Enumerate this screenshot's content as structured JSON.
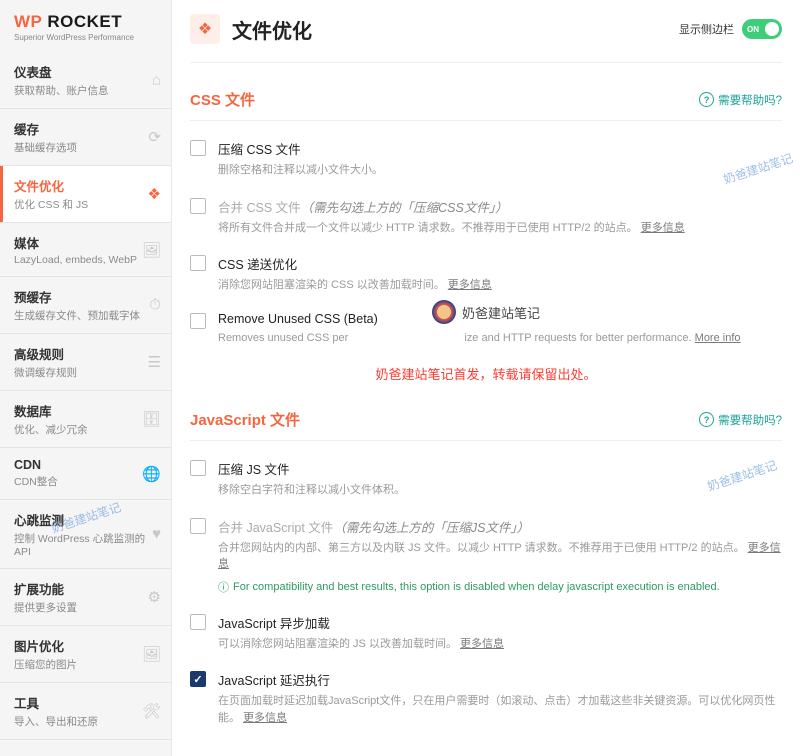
{
  "logo": {
    "wp": "WP",
    "rocket": "ROCKET",
    "tagline": "Superior WordPress Performance"
  },
  "nav": [
    {
      "title": "仪表盘",
      "sub": "获取帮助、账户信息",
      "icon": "⌂"
    },
    {
      "title": "缓存",
      "sub": "基础缓存选项",
      "icon": "⟳"
    },
    {
      "title": "文件优化",
      "sub": "优化 CSS 和 JS",
      "icon": "❖"
    },
    {
      "title": "媒体",
      "sub": "LazyLoad, embeds, WebP",
      "icon": "🖼"
    },
    {
      "title": "预缓存",
      "sub": "生成缓存文件、预加载字体",
      "icon": "⏱"
    },
    {
      "title": "高级规则",
      "sub": "微调缓存规则",
      "icon": "☰"
    },
    {
      "title": "数据库",
      "sub": "优化、减少冗余",
      "icon": "🗄"
    },
    {
      "title": "CDN",
      "sub": "CDN整合",
      "icon": "🌐"
    },
    {
      "title": "心跳监测",
      "sub": "控制 WordPress 心跳监测的 API",
      "icon": "♥"
    },
    {
      "title": "扩展功能",
      "sub": "提供更多设置",
      "icon": "⚙"
    },
    {
      "title": "图片优化",
      "sub": "压缩您的图片",
      "icon": "🖼"
    },
    {
      "title": "工具",
      "sub": "导入、导出和还原",
      "icon": "🛠"
    }
  ],
  "header": {
    "icon": "❖",
    "title": "文件优化",
    "toggle_label": "显示侧边栏",
    "toggle_state": "ON"
  },
  "help_label": "需要帮助吗?",
  "more_info": "更多信息",
  "more_info_en": "More info",
  "sections": {
    "css": {
      "title": "CSS 文件",
      "options": [
        {
          "title": "压缩 CSS 文件",
          "desc": "删除空格和注释以减小文件大小。"
        },
        {
          "title": "合并 CSS 文件",
          "title_note": "（需先勾选上方的「压缩CSS文件」）",
          "desc": "将所有文件合并成一个文件以减少 HTTP 请求数。不推荐用于已使用 HTTP/2 的站点。",
          "more": true,
          "disabled": true
        },
        {
          "title": "CSS 递送优化",
          "desc": "消除您网站阻塞渲染的 CSS 以改善加载时间。",
          "more": true
        },
        {
          "title": "Remove Unused CSS (Beta)",
          "desc_pre": "Removes unused CSS per",
          "desc_post": "ize and HTTP requests for better performance.",
          "more_en": true
        }
      ]
    },
    "js": {
      "title": "JavaScript 文件",
      "options": [
        {
          "title": "压缩 JS 文件",
          "desc": "移除空白字符和注释以减小文件体积。"
        },
        {
          "title": "合并 JavaScript 文件",
          "title_note": "（需先勾选上方的「压缩JS文件」）",
          "desc": "合并您网站内的内部、第三方以及内联 JS 文件。以减少 HTTP 请求数。不推荐用于已使用 HTTP/2 的站点。",
          "more": true,
          "disabled": true,
          "compat": "For compatibility and best results, this option is disabled when delay javascript execution is enabled."
        },
        {
          "title": "JavaScript 异步加载",
          "desc": "可以消除您网站阻塞渲染的 JS 以改善加载时间。",
          "more": true
        },
        {
          "title": "JavaScript 延迟执行",
          "desc": "在页面加载时延迟加载JavaScript文件，只在用户需要时（如滚动、点击）才加载这些非关键资源。可以优化网页性能。",
          "more": true,
          "checked": true
        }
      ]
    }
  },
  "watermark": {
    "diag": "奶爸建站笔记",
    "center": "奶爸建站笔记",
    "red_notice": "奶爸建站笔记首发，转载请保留出处。"
  }
}
